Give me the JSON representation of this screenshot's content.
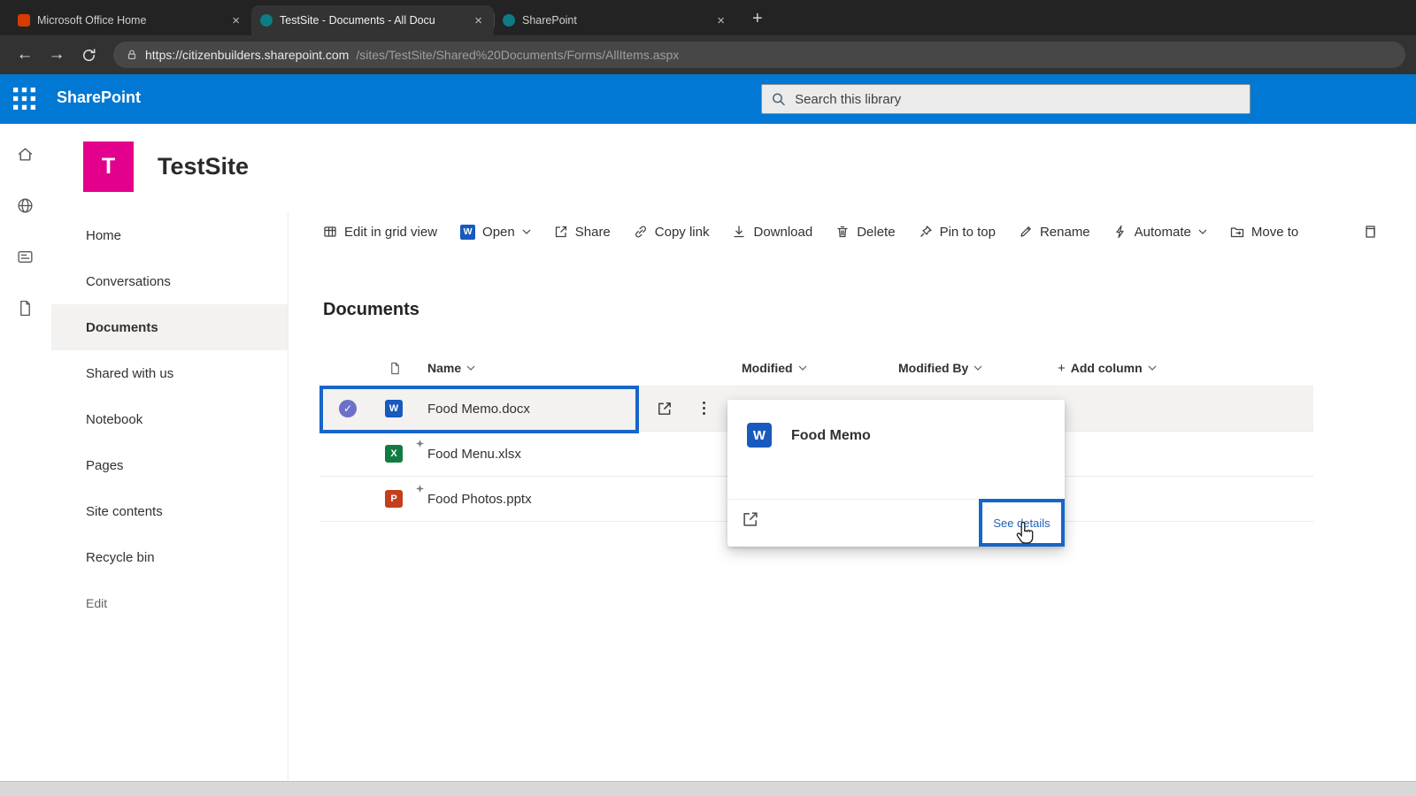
{
  "browser": {
    "tabs": [
      {
        "title": "Microsoft Office Home"
      },
      {
        "title": "TestSite - Documents - All Docu"
      },
      {
        "title": "SharePoint"
      }
    ],
    "url": {
      "host": "https://citizenbuilders.sharepoint.com",
      "path": "/sites/TestSite/Shared%20Documents/Forms/AllItems.aspx"
    }
  },
  "suite_bar": {
    "brand": "SharePoint",
    "search_placeholder": "Search this library"
  },
  "site": {
    "initial": "T",
    "name": "TestSite"
  },
  "nav": {
    "items": [
      {
        "label": "Home"
      },
      {
        "label": "Conversations"
      },
      {
        "label": "Documents"
      },
      {
        "label": "Shared with us"
      },
      {
        "label": "Notebook"
      },
      {
        "label": "Pages"
      },
      {
        "label": "Site contents"
      },
      {
        "label": "Recycle bin"
      },
      {
        "label": "Edit"
      }
    ]
  },
  "toolbar": {
    "items": [
      {
        "label": "Edit in grid view"
      },
      {
        "label": "Open"
      },
      {
        "label": "Share"
      },
      {
        "label": "Copy link"
      },
      {
        "label": "Download"
      },
      {
        "label": "Delete"
      },
      {
        "label": "Pin to top"
      },
      {
        "label": "Rename"
      },
      {
        "label": "Automate"
      },
      {
        "label": "Move to"
      }
    ]
  },
  "library": {
    "title": "Documents",
    "columns": {
      "name": "Name",
      "modified": "Modified",
      "modified_by": "Modified By",
      "add_column": "Add column"
    },
    "files": [
      {
        "name": "Food Memo.docx",
        "type": "word"
      },
      {
        "name": "Food Menu.xlsx",
        "type": "excel"
      },
      {
        "name": "Food Photos.pptx",
        "type": "powerpoint"
      }
    ]
  },
  "hover_card": {
    "title": "Food Memo",
    "see_details": "See details"
  },
  "icons": {
    "close": "×",
    "new_tab": "+",
    "back": "←",
    "forward": "→",
    "add": "+",
    "check": "✓",
    "word": "W",
    "excel": "X",
    "powerpoint": "P"
  },
  "colors": {
    "suite_blue": "#0078d4",
    "annotation_blue": "#1566c8",
    "site_logo_pink": "#e3008c",
    "word_blue": "#185abd",
    "excel_green": "#107c41",
    "powerpoint_red": "#c43e1c",
    "selected_check_purple": "#6b70c9"
  }
}
